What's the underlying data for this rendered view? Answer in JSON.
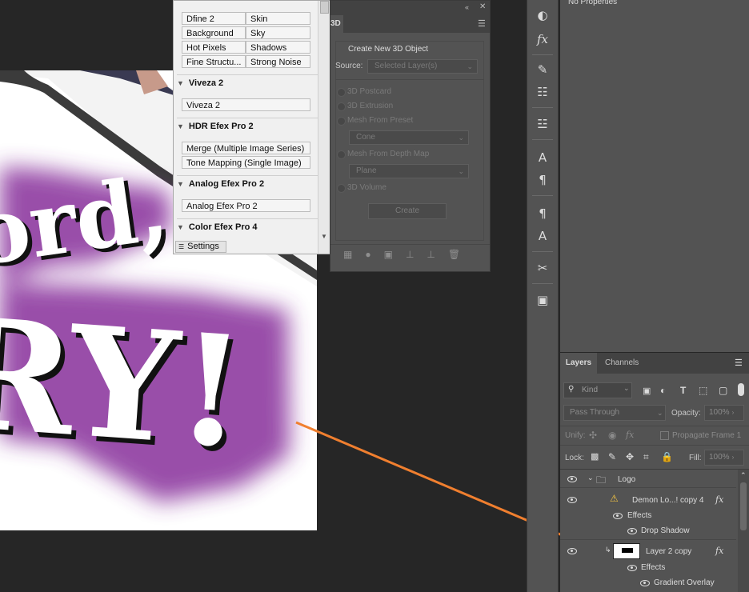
{
  "nik_panel": {
    "grid_buttons": [
      [
        "Dfine 2",
        "Skin"
      ],
      [
        "Background",
        "Sky"
      ],
      [
        "Hot Pixels",
        "Shadows"
      ],
      [
        "Fine Structu...",
        "Strong Noise"
      ]
    ],
    "sections": [
      {
        "title": "Viveza 2",
        "buttons": [
          "Viveza 2"
        ]
      },
      {
        "title": "HDR Efex Pro 2",
        "buttons": [
          "Merge (Multiple Image Series)",
          "Tone Mapping (Single Image)"
        ]
      },
      {
        "title": "Analog Efex Pro 2",
        "buttons": [
          "Analog Efex Pro 2"
        ]
      },
      {
        "title": "Color Efex Pro 4",
        "buttons": []
      }
    ],
    "settings_tab": "Settings"
  },
  "panel_3d": {
    "tab": "3D",
    "header": "Create New 3D Object",
    "source_label": "Source:",
    "source_value": "Selected Layer(s)",
    "options": [
      "3D Postcard",
      "3D Extrusion",
      "Mesh From Preset",
      "Mesh From Depth Map",
      "3D Volume"
    ],
    "preset_value": "Cone",
    "depth_value": "Plane",
    "create_button": "Create"
  },
  "properties": {
    "status": "No Properties"
  },
  "layers_panel": {
    "tabs": [
      "Layers",
      "Channels"
    ],
    "filter_kind": "Kind",
    "blend_mode": "Pass Through",
    "opacity_label": "Opacity:",
    "opacity_value": "100%",
    "unify_label": "Unify:",
    "propagate_label": "Propagate Frame 1",
    "lock_label": "Lock:",
    "fill_label": "Fill:",
    "fill_value": "100%",
    "layers": {
      "group": "Logo",
      "layer1": "Demon Lo...! copy 4",
      "layer1_effects": "Effects",
      "layer1_effect": "Drop Shadow",
      "layer2": "Layer 2 copy",
      "layer2_effects": "Effects",
      "layer2_effect": "Gradient Overlay",
      "fx": "fx"
    }
  },
  "colors": {
    "accent_arrow": "#f07f2f",
    "purple_glow": "#8e3aa0",
    "panel_bg": "#535353",
    "canvas_bg": "#262626"
  }
}
